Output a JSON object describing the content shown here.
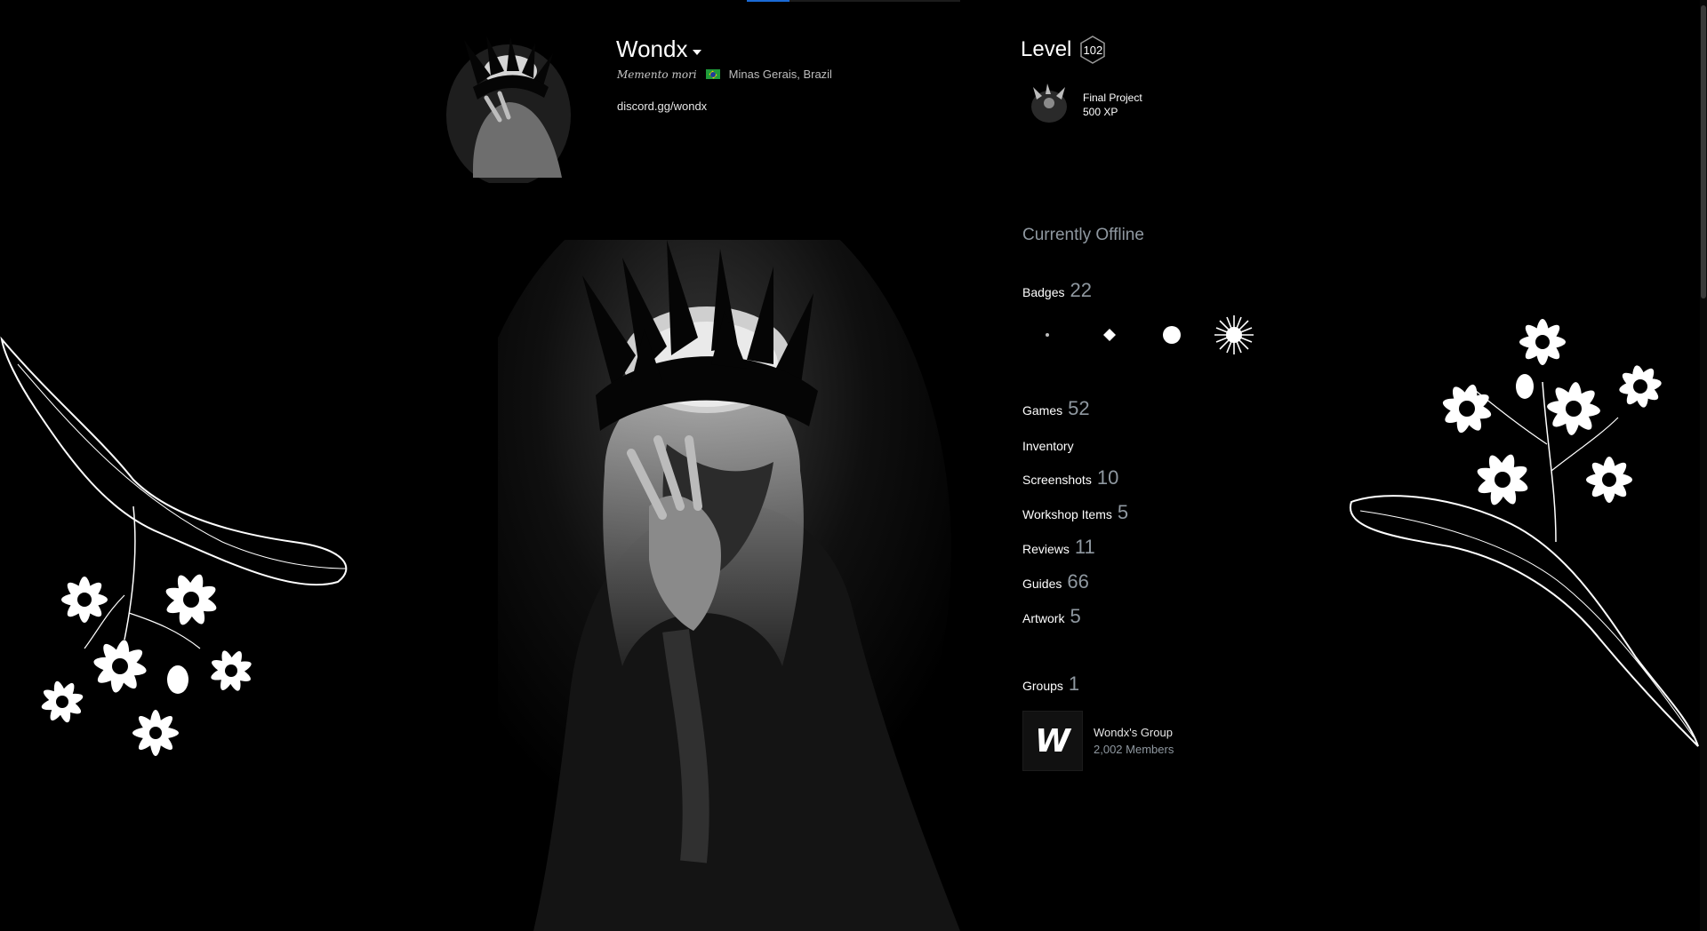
{
  "profile": {
    "persona_name": "Wondx",
    "motto": "Memento mori",
    "location": "Minas Gerais, Brazil",
    "summary": "discord.gg/wondx"
  },
  "level": {
    "label": "Level",
    "value": "102"
  },
  "favorite_badge": {
    "name": "Final Project",
    "xp": "500 XP"
  },
  "status": "Currently Offline",
  "stats": {
    "badges": {
      "label": "Badges",
      "count": "22"
    },
    "games": {
      "label": "Games",
      "count": "52"
    },
    "inventory": {
      "label": "Inventory"
    },
    "screenshots": {
      "label": "Screenshots",
      "count": "10"
    },
    "workshop": {
      "label": "Workshop Items",
      "count": "5"
    },
    "reviews": {
      "label": "Reviews",
      "count": "11"
    },
    "guides": {
      "label": "Guides",
      "count": "66"
    },
    "artwork": {
      "label": "Artwork",
      "count": "5"
    },
    "groups": {
      "label": "Groups",
      "count": "1"
    }
  },
  "group": {
    "logo_letter": "W",
    "name": "Wondx's Group",
    "members": "2,002 Members"
  },
  "colors": {
    "background": "#000000",
    "accent": "#1a6ad6",
    "muted_text": "#8f98a0"
  },
  "icons": [
    "caret-down-icon",
    "brazil-flag-icon",
    "level-hexagon-icon",
    "badge-dot-icon",
    "badge-diamond-icon",
    "badge-circle-icon",
    "badge-star-icon"
  ]
}
